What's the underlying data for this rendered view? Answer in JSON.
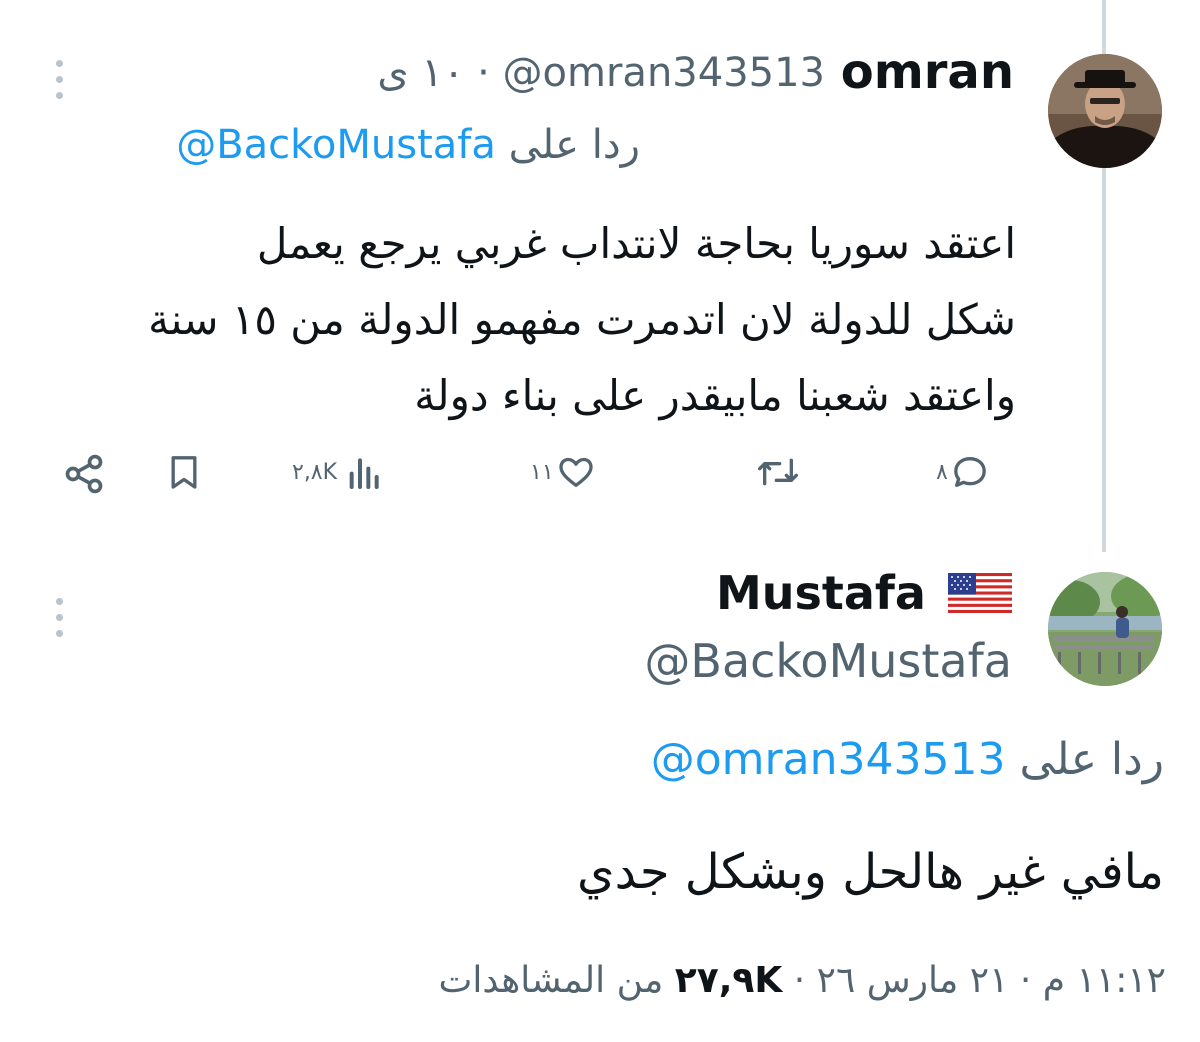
{
  "reply_tweet": {
    "display_name": "omran",
    "handle": "@omran343513",
    "separator": "·",
    "time": "١٠ ى",
    "replying_prefix": "ردا على",
    "replying_handle": "@BackoMustafa",
    "text_lines": [
      "اعتقد سوريا بحاجة لانتداب غربي يرجع يعمل",
      "شكل للدولة لان اتدمرت مفهمو الدولة من ١٥ سنة",
      "واعتقد شعبنا مابيقدر على بناء دولة"
    ],
    "actions": {
      "replies": "٨",
      "retweets": "",
      "likes": "١١",
      "views": "٢,٨K"
    },
    "icons": [
      "reply-icon",
      "retweet-icon",
      "like-icon",
      "views-icon",
      "bookmark-icon",
      "share-icon"
    ]
  },
  "main_tweet": {
    "display_name": "Mustafa",
    "flag": "🇺🇸",
    "handle": "@BackoMustafa",
    "replying_prefix": "ردا على",
    "replying_handle": "@omran343513",
    "text": "مافي غير هالحل وبشكل جدي",
    "time": "١١:١٢ م",
    "separator": "·",
    "date": "٢١ مارس ٢٦",
    "views_count": "٢٧,٩K",
    "views_label": "من المشاهدات"
  },
  "colors": {
    "accent": "#1d9bf0",
    "text": "#0f1419",
    "muted": "#536471",
    "thread_line": "#cfd9de",
    "more_dots": "#b9c3ca"
  }
}
